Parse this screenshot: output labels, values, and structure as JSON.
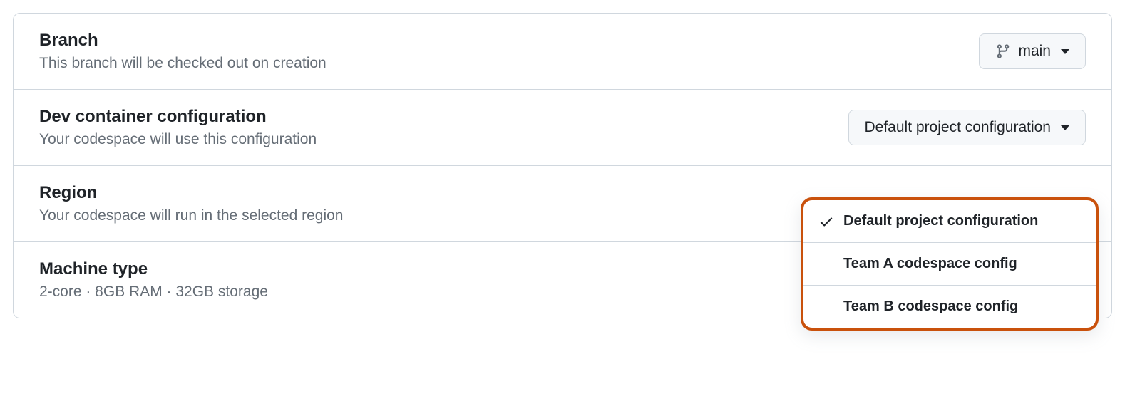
{
  "branch": {
    "title": "Branch",
    "desc": "This branch will be checked out on creation",
    "value": "main"
  },
  "devcontainer": {
    "title": "Dev container configuration",
    "desc": "Your codespace will use this configuration",
    "value": "Default project configuration",
    "options": [
      {
        "label": "Default project configuration",
        "selected": true
      },
      {
        "label": "Team A codespace config",
        "selected": false
      },
      {
        "label": "Team B codespace config",
        "selected": false
      }
    ]
  },
  "region": {
    "title": "Region",
    "desc": "Your codespace will run in the selected region"
  },
  "machine": {
    "title": "Machine type",
    "desc": "2-core · 8GB RAM · 32GB storage",
    "value": "2-core"
  }
}
